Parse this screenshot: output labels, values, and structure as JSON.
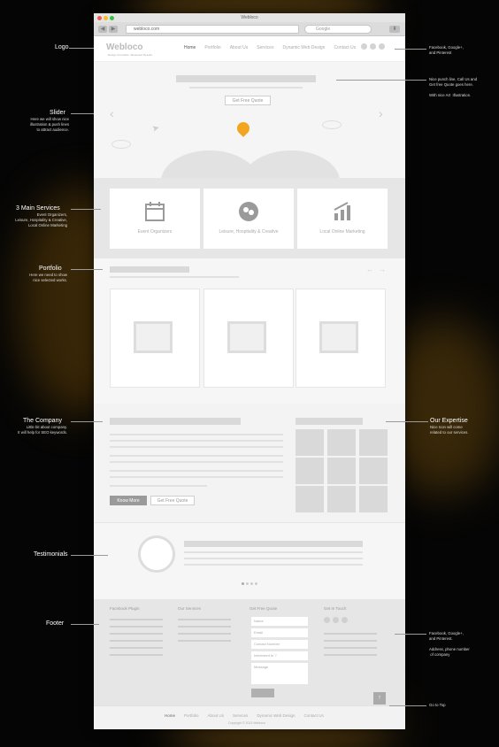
{
  "window": {
    "title": "Webloco",
    "url": "webloco.com",
    "search_placeholder": "Google"
  },
  "header": {
    "logo": "Webloco",
    "tagline": "Design Innovation. Measured Results.",
    "nav": [
      "Home",
      "Portfolio",
      "About Us",
      "Services",
      "Dynamic Web Design",
      "Contact Us"
    ]
  },
  "slider": {
    "button": "Get Free Quote"
  },
  "services": [
    "Event Organizers",
    "Leisure, Hospitality & Creative",
    "Local Online Marketing"
  ],
  "company": {
    "know_more": "Know More",
    "quote": "Get Free Quote"
  },
  "footer": {
    "headings": [
      "Facebook Plugin",
      "Our Services",
      "Get Free Quote",
      "Get In Touch"
    ],
    "fields": [
      "Name",
      "Email",
      "Contact Number",
      "Interested In ?",
      "Message"
    ],
    "nav": [
      "Home",
      "Portfolio",
      "About Us",
      "Services",
      "Dynamic Web Design",
      "Contact Us"
    ],
    "copyright": "Copyright © 2013 Webloco"
  },
  "annotations": {
    "logo": "Logo",
    "social": "Facebook, Google+,\nand Pinterest",
    "slider_title": "Slider",
    "slider_text": "Here we will show nice\nillustration & push lines\nto attract audience.",
    "punch": "Nice punch line, Call Us and\nGet free Quote goes here.\n\nWith nice Art  Illustration.",
    "services_title": "3 Main Services",
    "services_text": "Event Organizers,\nLeisure, Hospitality & Creative,\nLocal Online Marketing",
    "portfolio_title": "Portfolio",
    "portfolio_text": "Here we need to show\nnice selected works.",
    "company_title": "The Company",
    "company_text": "Little bit about company.\nIt will help for SEO keywords.",
    "expertise_title": "Our Expertise",
    "expertise_text": "Nice Icon will come\nrelated to our services.",
    "testimonials": "Testimonials",
    "footer_title": "Footer",
    "footer_text": "Facebook, Google+,\nand Pinterest.\n\nAddress, phone number\n of company",
    "top": "Go to Top"
  }
}
